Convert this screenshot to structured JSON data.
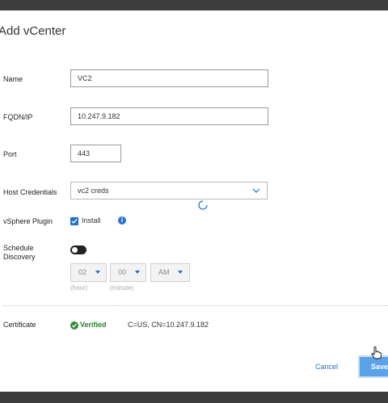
{
  "dialog": {
    "title": "Add vCenter"
  },
  "fields": {
    "name": {
      "label": "Name",
      "value": "VC2"
    },
    "fqdn": {
      "label": "FQDN/IP",
      "value": "10.247.9.182"
    },
    "port": {
      "label": "Port",
      "value": "443"
    },
    "credentials": {
      "label": "Host Credentials",
      "value": "vc2 creds"
    },
    "vsphere_plugin": {
      "label": "vSphere Plugin",
      "checkbox_label": "Install",
      "checked": true
    },
    "schedule": {
      "label_line1": "Schedule",
      "label_line2": "Discovery",
      "enabled": false,
      "hour": "02",
      "minute": "00",
      "ampm": "AM",
      "hour_hint": "(hour)",
      "minute_hint": "(minute)"
    },
    "certificate": {
      "label": "Certificate",
      "status": "Verified",
      "subject": "C=US, CN=10.247.9.182"
    }
  },
  "actions": {
    "cancel": "Cancel",
    "save": "Save"
  },
  "colors": {
    "accent": "#1f6fd1",
    "save_bg": "#5ba3e6",
    "verified": "#2e8b3a"
  },
  "icons": [
    "chevron-down-icon",
    "loading-spinner-icon",
    "check-icon",
    "info-icon",
    "verified-check-icon",
    "hand-cursor-icon"
  ]
}
